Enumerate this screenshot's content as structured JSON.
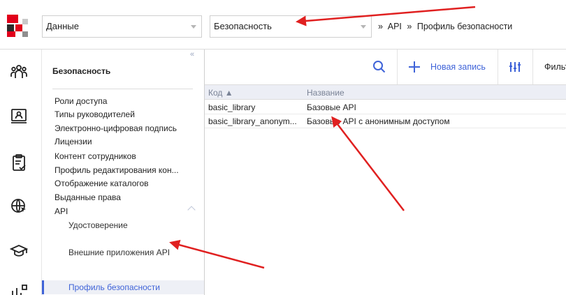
{
  "header": {
    "section_select": {
      "value": "Данные"
    },
    "subsection_select": {
      "value": "Безопасность"
    },
    "breadcrumb": [
      "»",
      "API",
      "»",
      "Профиль безопасности"
    ]
  },
  "rail": {
    "icons": [
      "users-icon",
      "id-card-icon",
      "clipboard-check-icon",
      "globe-cursor-icon",
      "graduation-cap-icon",
      "chart-icon"
    ]
  },
  "tree": {
    "collapse_glyph": "«",
    "title": "Безопасность",
    "items": [
      "Роли доступа",
      "Типы руководителей",
      "Электронно-цифровая подпись",
      "Лицензии",
      "Контент сотрудников",
      "Профиль редактирования кон...",
      "Отображение каталогов",
      "Выданные права",
      "API"
    ],
    "subitems": [
      "Удостоверение",
      "Профиль безопасности",
      "Внешние приложения API"
    ],
    "active": "Профиль безопасности"
  },
  "toolbar": {
    "new_record_label": "Новая запись",
    "filter_label": "Фильт"
  },
  "grid": {
    "columns": [
      "Код ▲",
      "Название"
    ],
    "rows": [
      [
        "basic_library",
        "Базовые API"
      ],
      [
        "basic_library_anonym...",
        "Базовые API с анонимным доступом"
      ]
    ]
  },
  "colors": {
    "accent": "#3f63d8",
    "annotation_arrow": "#e02020"
  }
}
